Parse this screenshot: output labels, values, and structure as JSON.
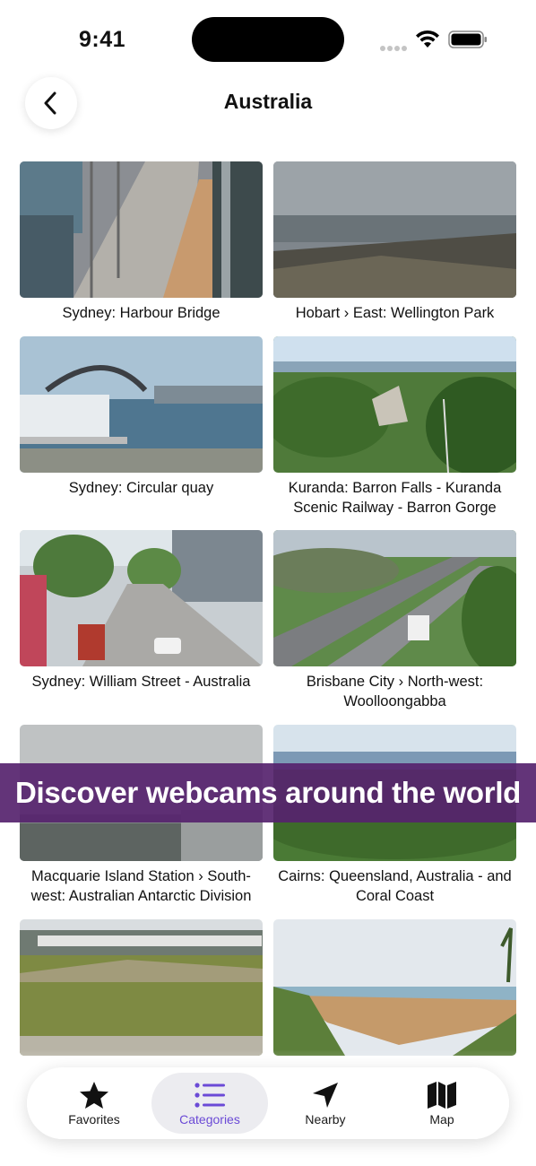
{
  "status_bar": {
    "time": "9:41"
  },
  "header": {
    "title": "Australia"
  },
  "webcams": [
    {
      "label": "Sydney: Harbour Bridge"
    },
    {
      "label": "Hobart › East: Wellington Park"
    },
    {
      "label": "Sydney: Circular quay"
    },
    {
      "label": "Kuranda: Barron Falls - Kuranda Scenic Railway - Barron Gorge"
    },
    {
      "label": "Sydney: William Street - Australia"
    },
    {
      "label": "Brisbane City › North-west: Woolloongabba"
    },
    {
      "label": "Macquarie Island Station › South-west: Australian Antarctic Division"
    },
    {
      "label": "Cairns: Queensland, Australia - and Coral Coast"
    },
    {
      "label": ""
    },
    {
      "label": ""
    }
  ],
  "banner": {
    "text": "Discover webcams around the world"
  },
  "tabs": [
    {
      "label": "Favorites",
      "icon": "star-icon",
      "active": false
    },
    {
      "label": "Categories",
      "icon": "list-icon",
      "active": true
    },
    {
      "label": "Nearby",
      "icon": "location-arrow-icon",
      "active": false
    },
    {
      "label": "Map",
      "icon": "map-icon",
      "active": false
    }
  ],
  "colors": {
    "accent": "#6b4ad6",
    "banner": "#56236e"
  }
}
